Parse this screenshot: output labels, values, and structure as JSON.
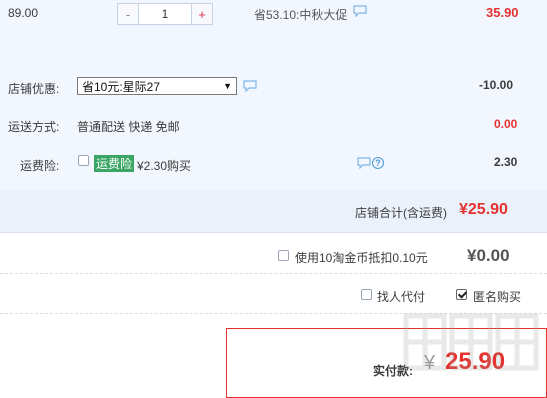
{
  "item": {
    "unit_price": "89.00",
    "quantity": "1",
    "minus_label": "-",
    "plus_label": "+",
    "promo_text": "省53.10:中秋大促",
    "subtotal": "35.90"
  },
  "shop": {
    "discount_label": "店铺优惠:",
    "discount_selected": "省10元:星际27",
    "discount_value": "-10.00",
    "shipping_label": "运送方式:",
    "shipping_value_text": "普通配送 快递 免邮",
    "shipping_value": "0.00",
    "insurance_label": "运费险:",
    "insurance_badge": "运费险",
    "insurance_price": "¥2.30购买",
    "insurance_value": "2.30",
    "help_glyph": "?",
    "total_label": "店铺合计(含运费)",
    "total_value": "¥25.90"
  },
  "coins": {
    "label": "使用10淘金币抵扣0.10元",
    "value": "¥0.00"
  },
  "options": {
    "proxy_pay_label": "找人代付",
    "anonymous_label": "匿名购买",
    "anonymous_checked": true
  },
  "payment": {
    "label": "实付款:",
    "currency": "¥",
    "amount": "25.90"
  },
  "icons": {
    "chat": "chat-bubble-icon",
    "help": "help-circle-icon",
    "dropdown": "dropdown-arrow-icon"
  },
  "colors": {
    "accent_red": "#e4322f",
    "panel_blue": "#f2f7ff",
    "badge_green": "#3aa565"
  }
}
